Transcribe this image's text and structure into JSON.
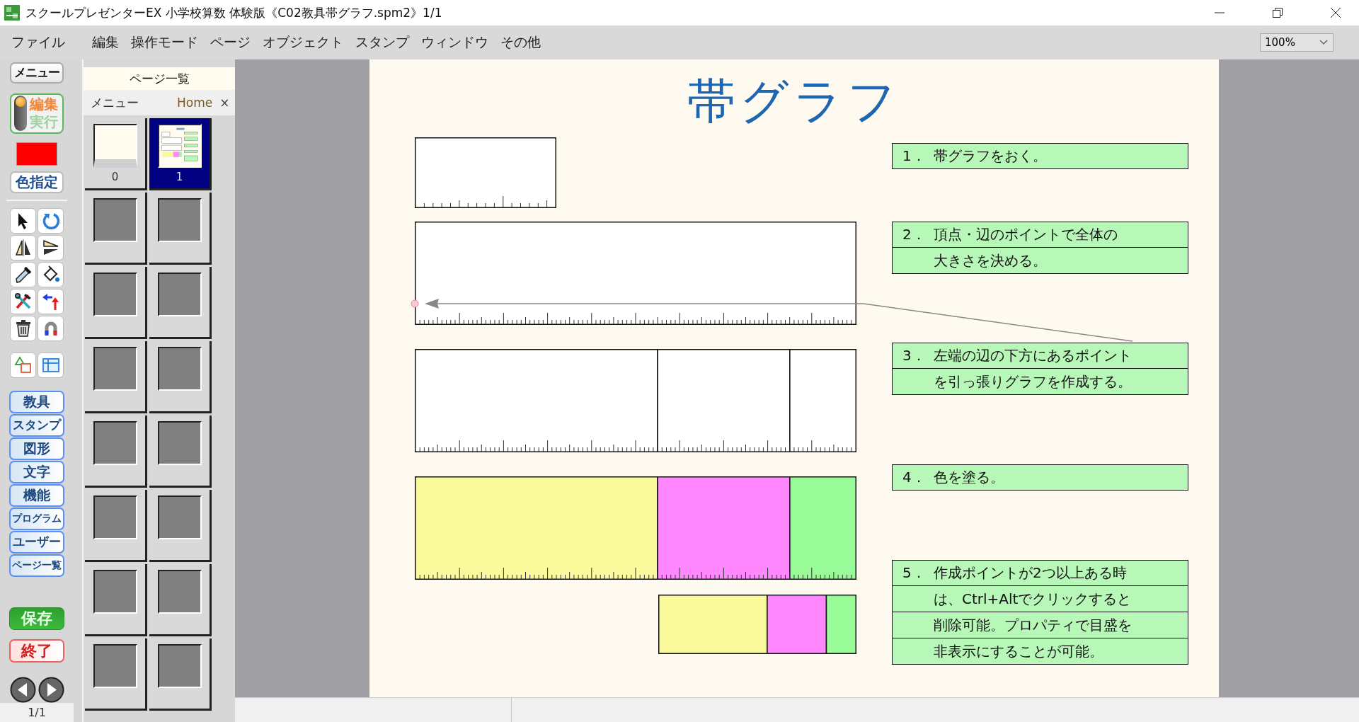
{
  "window": {
    "title": "スクールプレゼンターEX 小学校算数 体験版《C02教具帯グラフ.spm2》1/1"
  },
  "menu": [
    "ファイル",
    "編集",
    "操作モード",
    "ページ",
    "オブジェクト",
    "スタンプ",
    "ウィンドウ",
    "その他"
  ],
  "zoom": {
    "value": "100%"
  },
  "tools": {
    "menu_button": "メニュー",
    "edit_label": "編集",
    "run_label": "実行",
    "edit_mode": true,
    "swatch": {
      "color": "#ff0000"
    },
    "color_button": "色指定",
    "categories": [
      "教具",
      "スタンプ",
      "図形",
      "文字",
      "機能",
      "プログラム",
      "ユーザー",
      "ページ一覧"
    ],
    "save_button": "保存",
    "exit_button": "終了",
    "page_counter": "1/1"
  },
  "page_list": {
    "title": "ページ一覧",
    "tabs": [
      "メニュー",
      "Home"
    ],
    "close": "×",
    "pages": [
      {
        "kind": "page",
        "label": "0",
        "selected": false
      },
      {
        "kind": "page",
        "label": "1",
        "selected": true
      },
      {
        "kind": "empty",
        "selected": false
      },
      {
        "kind": "empty",
        "selected": false
      },
      {
        "kind": "empty",
        "selected": false
      },
      {
        "kind": "empty",
        "selected": false
      },
      {
        "kind": "empty",
        "selected": false
      },
      {
        "kind": "empty",
        "selected": false
      },
      {
        "kind": "empty",
        "selected": false
      },
      {
        "kind": "empty",
        "selected": false
      },
      {
        "kind": "empty",
        "selected": false
      },
      {
        "kind": "empty",
        "selected": false
      },
      {
        "kind": "empty",
        "selected": false
      },
      {
        "kind": "empty",
        "selected": false
      },
      {
        "kind": "empty",
        "selected": false
      },
      {
        "kind": "empty",
        "selected": false
      }
    ]
  },
  "slide": {
    "title": "帯グラフ",
    "graphs": [
      {
        "ticks": true,
        "segments": [
          {
            "color": "#ffffff"
          }
        ]
      },
      {
        "ticks": true,
        "segments": [
          {
            "color": "#ffffff"
          }
        ]
      },
      {
        "ticks": true,
        "segments": [
          {
            "color": "#ffffff"
          },
          {
            "color": "#ffffff"
          },
          {
            "color": "#ffffff"
          }
        ]
      },
      {
        "ticks": true,
        "segments": [
          {
            "color": "#fafa9c"
          },
          {
            "color": "#ff88ff"
          },
          {
            "color": "#98fb98"
          }
        ]
      },
      {
        "ticks": false,
        "segments": [
          {
            "color": "#fafa9c"
          },
          {
            "color": "#ff88ff"
          },
          {
            "color": "#98fb98"
          }
        ]
      }
    ],
    "steps": [
      {
        "number": "1．",
        "lines": [
          "帯グラフをおく。"
        ]
      },
      {
        "number": "2．",
        "lines": [
          "頂点・辺のポイントで全体の",
          "大きさを決める。"
        ]
      },
      {
        "number": "3．",
        "lines": [
          "左端の辺の下方にあるポイント",
          "を引っ張りグラフを作成する。"
        ]
      },
      {
        "number": "4．",
        "lines": [
          "色を塗る。"
        ]
      },
      {
        "number": "5．",
        "lines": [
          "作成ポイントが2つ以上ある時",
          "は、Ctrl+Altでクリックすると",
          "削除可能。プロパティで目盛を",
          "非表示にすることが可能。"
        ]
      }
    ]
  }
}
